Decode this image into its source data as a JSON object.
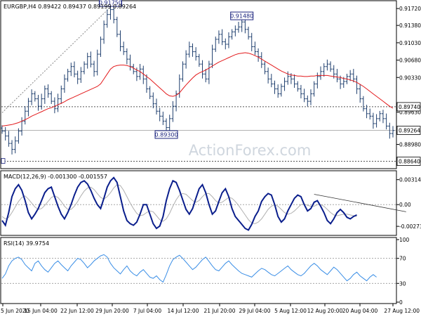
{
  "chart_data": [
    {
      "type": "ohlc",
      "symbol_header": "EURGBP,H4  0.89422 0.89437 0.89199 0.89264",
      "ylim": [
        0.8852,
        0.9185
      ],
      "y_ticks": [
        {
          "value": 0.9172,
          "label": "0.91720"
        },
        {
          "value": 0.9138,
          "label": "0.91380"
        },
        {
          "value": 0.9103,
          "label": "0.91030"
        },
        {
          "value": 0.9068,
          "label": "0.90680"
        },
        {
          "value": 0.9033,
          "label": "0.90330"
        },
        {
          "value": 0.8963,
          "label": "0.89630"
        },
        {
          "value": 0.8898,
          "label": "0.88980"
        }
      ],
      "price_tags": [
        {
          "value": 0.8974,
          "label": "0.89740"
        },
        {
          "value": 0.89264,
          "label": "0.89264"
        },
        {
          "value": 0.8864,
          "label": "0.88640"
        }
      ],
      "horizontal_levels": [
        0.8974,
        0.8864
      ],
      "last_price": 0.89264,
      "annotations": [
        {
          "label": "0.91750",
          "x": 33,
          "y": 0.9175
        },
        {
          "label": "0.91480",
          "x": 73,
          "y": 0.9148
        },
        {
          "label": "0.89300",
          "x": 50,
          "y": 0.893
        }
      ],
      "trendlines": [
        {
          "x1": 0,
          "y1": 0.8962,
          "x2": 33,
          "y2": 0.9175
        }
      ],
      "closes": [
        0.8925,
        0.8915,
        0.89,
        0.8888,
        0.8905,
        0.8925,
        0.8945,
        0.8965,
        0.8985,
        0.9,
        0.899,
        0.8975,
        0.899,
        0.901,
        0.9,
        0.8985,
        0.897,
        0.899,
        0.901,
        0.903,
        0.9045,
        0.9055,
        0.904,
        0.903,
        0.9045,
        0.906,
        0.9075,
        0.906,
        0.9045,
        0.908,
        0.911,
        0.914,
        0.916,
        0.917,
        0.915,
        0.912,
        0.9095,
        0.9085,
        0.907,
        0.9055,
        0.9045,
        0.9035,
        0.905,
        0.903,
        0.901,
        0.8995,
        0.898,
        0.8965,
        0.8955,
        0.8945,
        0.8932,
        0.895,
        0.8975,
        0.9,
        0.903,
        0.906,
        0.908,
        0.9095,
        0.9085,
        0.9075,
        0.906,
        0.904,
        0.903,
        0.906,
        0.909,
        0.911,
        0.912,
        0.9105,
        0.91,
        0.9115,
        0.9125,
        0.913,
        0.9135,
        0.9145,
        0.913,
        0.9115,
        0.9095,
        0.9085,
        0.9075,
        0.906,
        0.9045,
        0.903,
        0.902,
        0.901,
        0.9,
        0.9015,
        0.9025,
        0.9035,
        0.903,
        0.902,
        0.901,
        0.9,
        0.899,
        0.8985,
        0.9,
        0.902,
        0.9035,
        0.9045,
        0.9055,
        0.906,
        0.905,
        0.904,
        0.903,
        0.902,
        0.9025,
        0.9035,
        0.904,
        0.903,
        0.901,
        0.899,
        0.897,
        0.896,
        0.8955,
        0.894,
        0.895,
        0.896,
        0.895,
        0.8935,
        0.892,
        0.8926
      ],
      "ma_values": [
        0.8935,
        0.8936,
        0.8937,
        0.8938,
        0.894,
        0.8942,
        0.8945,
        0.8948,
        0.8951,
        0.8955,
        0.8958,
        0.8961,
        0.8964,
        0.8967,
        0.897,
        0.8972,
        0.8975,
        0.8978,
        0.8981,
        0.8984,
        0.8988,
        0.8991,
        0.8994,
        0.8997,
        0.9,
        0.9003,
        0.9006,
        0.9009,
        0.9012,
        0.9015,
        0.902,
        0.903,
        0.904,
        0.905,
        0.9055,
        0.9057,
        0.9058,
        0.9058,
        0.9057,
        0.9055,
        0.9052,
        0.9048,
        0.9045,
        0.904,
        0.9035,
        0.903,
        0.9024,
        0.9018,
        0.9012,
        0.9006,
        0.9,
        0.8996,
        0.8995,
        0.8997,
        0.9002,
        0.901,
        0.9018,
        0.9025,
        0.9032,
        0.9038,
        0.9042,
        0.9045,
        0.9048,
        0.9052,
        0.9056,
        0.906,
        0.9064,
        0.9067,
        0.907,
        0.9073,
        0.9076,
        0.9079,
        0.9081,
        0.9082,
        0.9083,
        0.9082,
        0.908,
        0.9077,
        0.9074,
        0.907,
        0.9066,
        0.9062,
        0.9058,
        0.9054,
        0.905,
        0.9046,
        0.9043,
        0.904,
        0.9038,
        0.9037,
        0.9036,
        0.9036,
        0.9035,
        0.9035,
        0.9036,
        0.9036,
        0.9037,
        0.9037,
        0.9037,
        0.9037,
        0.9036,
        0.9035,
        0.9034,
        0.9033,
        0.9031,
        0.903,
        0.9028,
        0.9026,
        0.9023,
        0.9019,
        0.9015,
        0.901,
        0.9005,
        0.9,
        0.8995,
        0.899,
        0.8985,
        0.898,
        0.8975,
        0.8971
      ]
    },
    {
      "type": "line",
      "header": "MACD(12,26,9) -0.001300 -0.001557",
      "ylim": [
        -0.0037,
        0.004
      ],
      "y_ticks": [
        {
          "value": 0.003143,
          "label": "0.003143"
        },
        {
          "value": 0.0,
          "label": "0.00"
        },
        {
          "value": -0.002737,
          "label": "-0.002737"
        }
      ],
      "zero_line": 0.0,
      "macd": [
        -0.002,
        -0.0026,
        -0.001,
        0.001,
        0.002,
        0.0025,
        0.0018,
        0.0005,
        -0.001,
        -0.0018,
        -0.0012,
        -0.0005,
        0.0005,
        0.0015,
        0.002,
        0.0022,
        0.001,
        -0.0002,
        -0.0012,
        -0.0018,
        -0.001,
        0.0,
        0.0012,
        0.0022,
        0.0028,
        0.003,
        0.0026,
        0.0018,
        0.0008,
        0.0,
        -0.0005,
        0.0008,
        0.0022,
        0.003,
        0.0034,
        0.0028,
        0.001,
        -0.0008,
        -0.002,
        -0.0024,
        -0.0026,
        -0.0022,
        -0.0012,
        0.0,
        0.0,
        -0.0012,
        -0.0024,
        -0.003,
        -0.0027,
        -0.0015,
        0.0005,
        0.002,
        0.003,
        0.0028,
        0.0018,
        0.0006,
        -0.0006,
        -0.0012,
        -0.0005,
        0.0008,
        0.002,
        0.0025,
        0.0015,
        0.0,
        -0.0012,
        -0.0008,
        0.0004,
        0.0015,
        0.002,
        0.001,
        -0.0005,
        -0.0015,
        -0.002,
        -0.0025,
        -0.003,
        -0.0032,
        -0.0025,
        -0.0015,
        -0.0008,
        0.0004,
        0.001,
        0.0014,
        0.0012,
        0.0,
        -0.0015,
        -0.0022,
        -0.0018,
        -0.0008,
        0.0,
        0.0008,
        0.0012,
        0.001,
        0.0,
        -0.0008,
        -0.0005,
        0.0003,
        0.0005,
        -0.0002,
        -0.001,
        -0.002,
        -0.0024,
        -0.0018,
        -0.001,
        -0.0006,
        -0.001,
        -0.0016,
        -0.0018,
        -0.0015,
        -0.0013
      ],
      "signal": [
        -0.0015,
        -0.0018,
        -0.0016,
        -0.001,
        -0.0003,
        0.0004,
        0.0009,
        0.0011,
        0.0007,
        0.0002,
        -0.0003,
        -0.0006,
        -0.0005,
        -0.0001,
        0.0004,
        0.0009,
        0.0011,
        0.0009,
        0.0004,
        -0.0002,
        -0.0006,
        -0.0006,
        -0.0002,
        0.0004,
        0.0011,
        0.0017,
        0.0021,
        0.0022,
        0.0019,
        0.0014,
        0.0009,
        0.0007,
        0.001,
        0.0015,
        0.0021,
        0.0025,
        0.0024,
        0.0018,
        0.001,
        0.0002,
        -0.0005,
        -0.0011,
        -0.0014,
        -0.0013,
        -0.001,
        -0.0008,
        -0.0009,
        -0.0014,
        -0.0019,
        -0.0021,
        -0.0018,
        -0.0011,
        -0.0002,
        0.0006,
        0.0012,
        0.0014,
        0.0013,
        0.0009,
        0.0005,
        0.0003,
        0.0005,
        0.001,
        0.0014,
        0.0014,
        0.001,
        0.0005,
        0.0002,
        0.0003,
        0.0006,
        0.0009,
        0.0008,
        0.0004,
        -0.0001,
        -0.0007,
        -0.0013,
        -0.0019,
        -0.0023,
        -0.0024,
        -0.0022,
        -0.0018,
        -0.0012,
        -0.0006,
        -0.0002,
        0.0,
        -0.0002,
        -0.0006,
        -0.001,
        -0.0012,
        -0.0011,
        -0.0008,
        -0.0004,
        0.0,
        0.0001,
        -0.0001,
        -0.0002,
        -0.0002,
        0.0,
        0.0,
        -0.0002,
        -0.0006,
        -0.001,
        -0.0013,
        -0.0014,
        -0.0013,
        -0.0012,
        -0.0012,
        -0.0013,
        -0.0014,
        -0.0015
      ],
      "trendline": {
        "x1": 95,
        "y1": 0.0013,
        "x2": 123,
        "y2": -0.0009
      }
    },
    {
      "type": "line",
      "header": "RSI(14) 39.9754",
      "ylim": [
        0,
        100
      ],
      "y_ticks": [
        {
          "value": 100,
          "label": "100"
        },
        {
          "value": 70,
          "label": "70"
        },
        {
          "value": 30,
          "label": "30"
        },
        {
          "value": 0,
          "label": "0"
        }
      ],
      "levels": [
        70,
        30
      ],
      "values": [
        38,
        45,
        58,
        66,
        70,
        72,
        68,
        60,
        55,
        50,
        62,
        66,
        58,
        52,
        48,
        55,
        62,
        66,
        60,
        55,
        50,
        58,
        64,
        70,
        68,
        62,
        55,
        60,
        66,
        70,
        74,
        76,
        72,
        62,
        55,
        50,
        45,
        52,
        58,
        50,
        45,
        42,
        48,
        52,
        46,
        40,
        38,
        42,
        36,
        32,
        44,
        58,
        68,
        72,
        75,
        70,
        64,
        58,
        52,
        56,
        62,
        68,
        72,
        65,
        58,
        52,
        50,
        56,
        62,
        66,
        60,
        55,
        50,
        46,
        44,
        42,
        40,
        45,
        50,
        54,
        52,
        48,
        44,
        42,
        46,
        50,
        54,
        58,
        52,
        48,
        44,
        42,
        46,
        52,
        58,
        62,
        58,
        52,
        48,
        44,
        50,
        56,
        52,
        46,
        40,
        34,
        38,
        44,
        48,
        42,
        38,
        34,
        40,
        44,
        40
      ]
    }
  ],
  "x_axis": {
    "labels": [
      "5 Jun 2020",
      "15 Jun 04:00",
      "22 Jun 12:00",
      "29 Jun 20:00",
      "7 Jul 04:00",
      "14 Jul 12:00",
      "21 Jul 20:00",
      "29 Jul 04:00",
      "5 Aug 12:00",
      "12 Aug 20:00",
      "20 Aug 04:00",
      "27 Aug 12:00"
    ]
  },
  "watermark": "ActionForex.com",
  "colors": {
    "price_bars": "#1f3f6e",
    "moving_average": "#e31a1c",
    "macd_line": "#0a1e8c",
    "macd_signal": "#b0b0b0",
    "rsi_line": "#3a8ee6",
    "level_line": "#808080",
    "watermark": "#cfd6de"
  }
}
